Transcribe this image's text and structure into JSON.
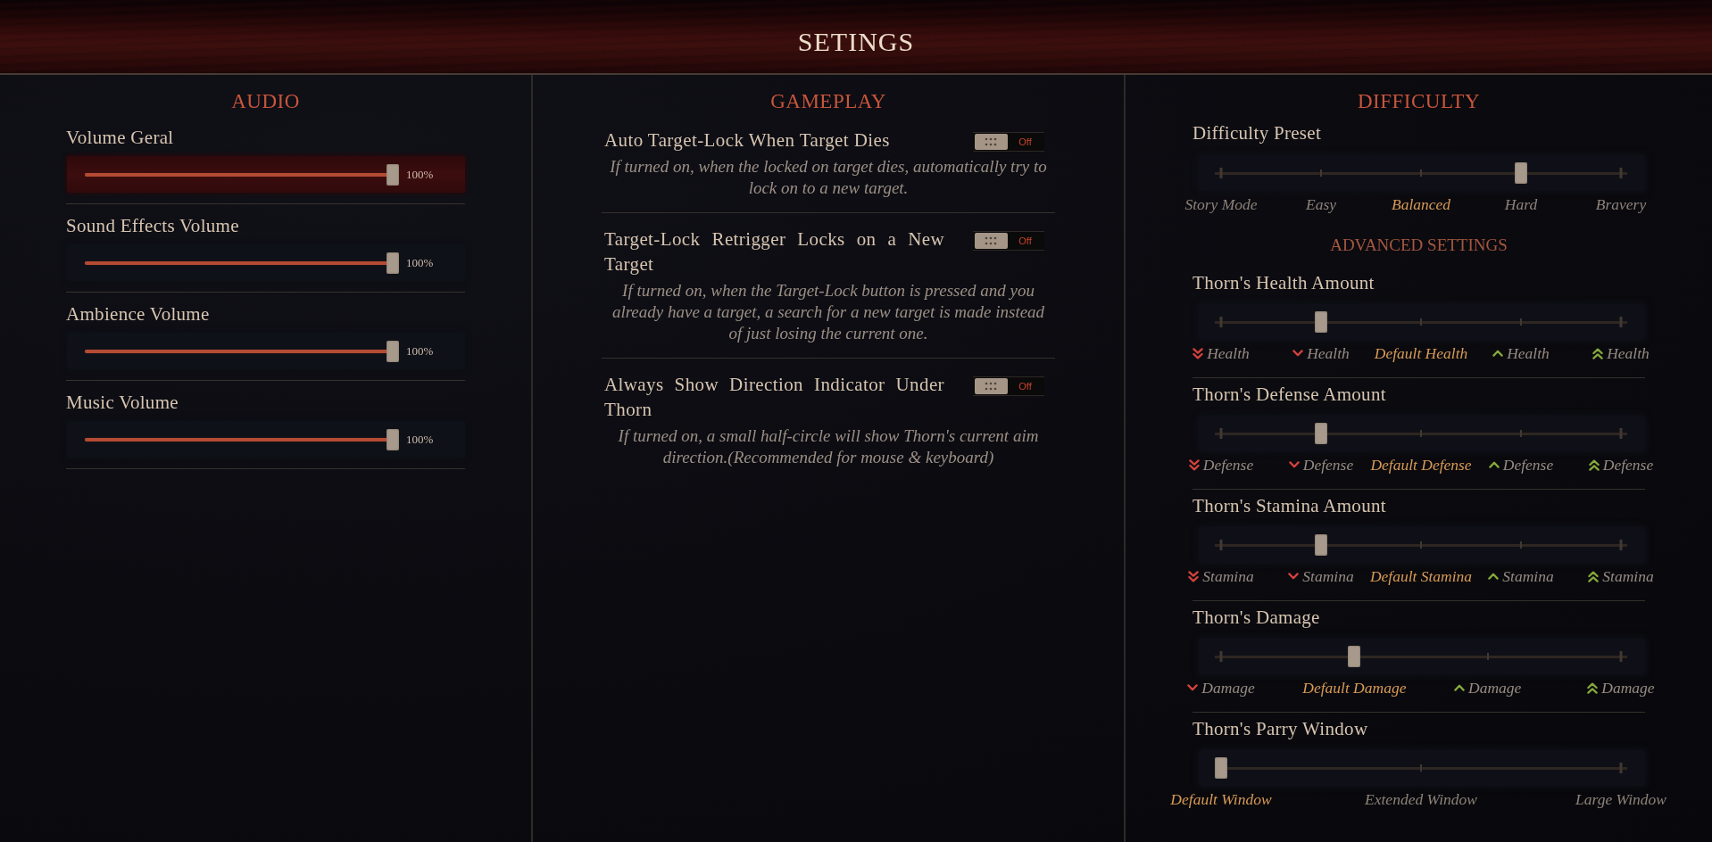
{
  "header": {
    "title": "SETINGS"
  },
  "audio": {
    "heading": "AUDIO",
    "sliders": [
      {
        "label": "Volume Geral",
        "level": 1,
        "reading": "100%",
        "selected": true
      },
      {
        "label": "Sound Effects Volume",
        "level": 1,
        "reading": "100%",
        "selected": false
      },
      {
        "label": "Ambience Volume",
        "level": 1,
        "reading": "100%",
        "selected": false
      },
      {
        "label": "Music Volume",
        "level": 1,
        "reading": "100%",
        "selected": false
      }
    ]
  },
  "gameplay": {
    "heading": "GAMEPLAY",
    "options": [
      {
        "label": "Auto Target-Lock When Target Dies",
        "on": false,
        "state_label": "Off",
        "description": "If turned on, when the locked on target dies, automatically try to lock on to a new target."
      },
      {
        "label": "Target-Lock Retrigger Locks on a New Target",
        "on": false,
        "state_label": "Off",
        "description": "If turned on, when the Target-Lock button is pressed and you already have a target, a search for a new target is made instead of just losing the current one."
      },
      {
        "label": "Always Show Direction Indicator Under Thorn",
        "on": false,
        "state_label": "Off",
        "description": "If turned on, a small half-circle will show Thorn's current aim direction.(Recommended for mouse & keyboard)"
      }
    ]
  },
  "difficulty": {
    "heading": "DIFFICULTY",
    "preset": {
      "label": "Difficulty Preset",
      "level": 0.75,
      "stops": [
        {
          "text": "Story Mode",
          "kind": "plain"
        },
        {
          "text": "Easy",
          "kind": "plain"
        },
        {
          "text": "Balanced",
          "kind": "default"
        },
        {
          "text": "Hard",
          "kind": "plain"
        },
        {
          "text": "Bravery",
          "kind": "plain"
        }
      ]
    },
    "advanced_heading": "ADVANCED SETTINGS",
    "advanced": [
      {
        "label": "Thorn's Health Amount",
        "level": 0.25,
        "stops": [
          {
            "text": "Health",
            "kind": "much-lower"
          },
          {
            "text": "Health",
            "kind": "lower"
          },
          {
            "text": "Default Health",
            "kind": "default"
          },
          {
            "text": "Health",
            "kind": "higher"
          },
          {
            "text": "Health",
            "kind": "much-higher"
          }
        ]
      },
      {
        "label": "Thorn's Defense Amount",
        "level": 0.25,
        "stops": [
          {
            "text": "Defense",
            "kind": "much-lower"
          },
          {
            "text": "Defense",
            "kind": "lower"
          },
          {
            "text": "Default Defense",
            "kind": "default"
          },
          {
            "text": "Defense",
            "kind": "higher"
          },
          {
            "text": "Defense",
            "kind": "much-higher"
          }
        ]
      },
      {
        "label": "Thorn's Stamina Amount",
        "level": 0.25,
        "stops": [
          {
            "text": "Stamina",
            "kind": "much-lower"
          },
          {
            "text": "Stamina",
            "kind": "lower"
          },
          {
            "text": "Default Stamina",
            "kind": "default"
          },
          {
            "text": "Stamina",
            "kind": "higher"
          },
          {
            "text": "Stamina",
            "kind": "much-higher"
          }
        ]
      },
      {
        "label": "Thorn's Damage",
        "level": 0.3333,
        "stops": [
          {
            "text": "Damage",
            "kind": "lower"
          },
          {
            "text": "Default Damage",
            "kind": "default"
          },
          {
            "text": "Damage",
            "kind": "higher"
          },
          {
            "text": "Damage",
            "kind": "much-higher"
          }
        ]
      },
      {
        "label": "Thorn's Parry Window",
        "level": 0,
        "stops": [
          {
            "text": "Default Window",
            "kind": "default"
          },
          {
            "text": "Extended Window",
            "kind": "plain"
          },
          {
            "text": "Large Window",
            "kind": "plain"
          }
        ]
      }
    ]
  }
}
